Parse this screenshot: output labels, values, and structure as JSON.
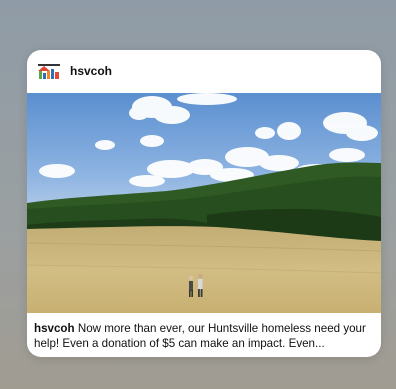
{
  "post": {
    "username": "hsvcoh",
    "avatar_icon": "hsvcoh-logo-icon",
    "image_icon": "landscape-photo",
    "caption_user": "hsvcoh",
    "caption_text": " Now more than ever, our Huntsville homeless need your help! Even a donation of $5 can make an impact. Even..."
  },
  "colors": {
    "logo_red": "#e0483a",
    "logo_green": "#5aa44a",
    "logo_blue": "#2f6fb4",
    "logo_orange": "#f08a24"
  }
}
